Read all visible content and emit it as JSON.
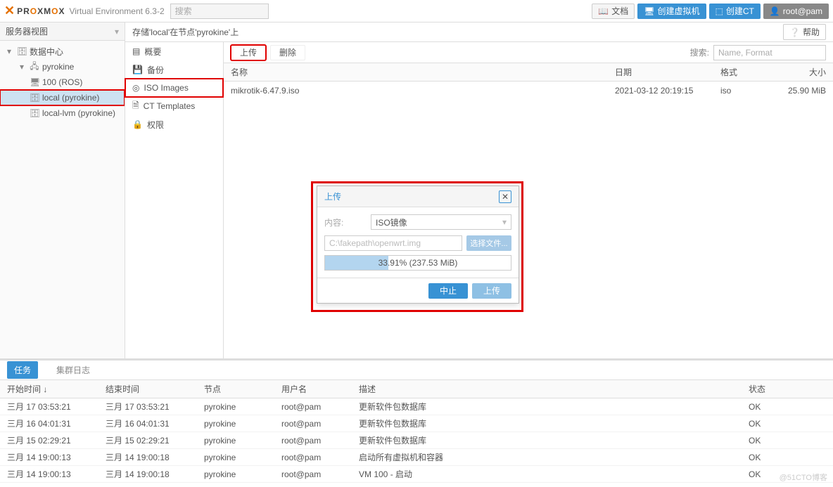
{
  "header": {
    "product": "PROXMOX",
    "version": "Virtual Environment 6.3-2",
    "search_placeholder": "搜索",
    "docs": "文档",
    "create_vm": "创建虚拟机",
    "create_ct": "创建CT",
    "user": "root@pam"
  },
  "sidebar": {
    "view": "服务器视图",
    "datacenter": "数据中心",
    "node": "pyrokine",
    "vm": "100 (ROS)",
    "storage_local": "local (pyrokine)",
    "storage_lvm": "local-lvm (pyrokine)"
  },
  "breadcrumb": "存储'local'在节点'pyrokine'上",
  "help": "帮助",
  "submenu": {
    "summary": "概要",
    "backup": "备份",
    "iso": "ISO Images",
    "ct": "CT Templates",
    "perm": "权限"
  },
  "toolbar": {
    "upload": "上传",
    "remove": "删除",
    "search_label": "搜索:",
    "search_placeholder": "Name, Format"
  },
  "columns": {
    "name": "名称",
    "date": "日期",
    "format": "格式",
    "size": "大小"
  },
  "rows": [
    {
      "name": "mikrotik-6.47.9.iso",
      "date": "2021-03-12 20:19:15",
      "format": "iso",
      "size": "25.90 MiB"
    }
  ],
  "dialog": {
    "title": "上传",
    "content_label": "内容:",
    "content_value": "ISO镜像",
    "path": "C:\\fakepath\\openwrt.img",
    "browse": "选择文件...",
    "progress_pct": 33.91,
    "progress_text": "33.91% (237.53 MiB)",
    "abort": "中止",
    "upload": "上传"
  },
  "bottom": {
    "tabs": {
      "tasks": "任务",
      "cluster": "集群日志"
    },
    "columns": {
      "start": "开始时间 ↓",
      "end": "结束时间",
      "node": "节点",
      "user": "用户名",
      "desc": "描述",
      "status": "状态"
    },
    "rows": [
      {
        "start": "三月 17 03:53:21",
        "end": "三月 17 03:53:21",
        "node": "pyrokine",
        "user": "root@pam",
        "desc": "更新软件包数据库",
        "status": "OK"
      },
      {
        "start": "三月 16 04:01:31",
        "end": "三月 16 04:01:31",
        "node": "pyrokine",
        "user": "root@pam",
        "desc": "更新软件包数据库",
        "status": "OK"
      },
      {
        "start": "三月 15 02:29:21",
        "end": "三月 15 02:29:21",
        "node": "pyrokine",
        "user": "root@pam",
        "desc": "更新软件包数据库",
        "status": "OK"
      },
      {
        "start": "三月 14 19:00:13",
        "end": "三月 14 19:00:18",
        "node": "pyrokine",
        "user": "root@pam",
        "desc": "启动所有虚拟机和容器",
        "status": "OK"
      },
      {
        "start": "三月 14 19:00:13",
        "end": "三月 14 19:00:18",
        "node": "pyrokine",
        "user": "root@pam",
        "desc": "VM 100 - 启动",
        "status": "OK"
      }
    ]
  },
  "watermark": "@51CTO博客"
}
